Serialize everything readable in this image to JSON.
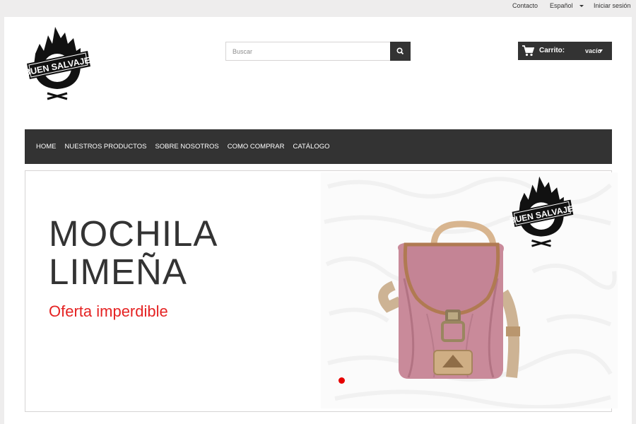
{
  "topbar": {
    "contact": "Contacto",
    "language": "Español",
    "login": "Iniciar sesión"
  },
  "brand": {
    "name": "BUEN SALVAJE"
  },
  "search": {
    "placeholder": "Buscar",
    "button_icon": "search-icon"
  },
  "cart": {
    "label": "Carrito:",
    "value": "vacío",
    "icon": "cart-icon"
  },
  "nav": {
    "items": [
      "HOME",
      "NUESTROS PRODUCTOS",
      "SOBRE NOSOTROS",
      "COMO COMPRAR",
      "CATÁLOGO"
    ]
  },
  "slide": {
    "title_line1": "MOCHILA",
    "title_line2": "LIMEÑA",
    "subtitle": "Oferta imperdible"
  },
  "colors": {
    "dark": "#333333",
    "accent_red": "#e52323",
    "bag_pink": "#c98a9a"
  }
}
